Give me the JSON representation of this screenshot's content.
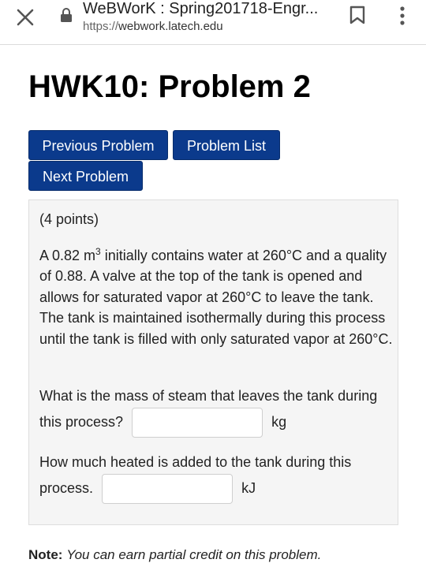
{
  "browser": {
    "tab_title": "WeBWorK : Spring201718-Engr...",
    "url_prefix": "https://",
    "url_host": "webwork.latech.edu"
  },
  "page": {
    "title": "HWK10: Problem 2"
  },
  "nav": {
    "previous_label": "Previous Problem",
    "list_label": "Problem List",
    "next_label": "Next Problem"
  },
  "problem": {
    "points": "(4 points)",
    "text_a": "A 0.82 m",
    "text_sup": "3",
    "text_b": " initially contains water at 260°C and a quality of 0.88. A valve at the top of the tank is opened and allows for saturated vapor at 260°C to leave the tank. The tank is maintained isothermally during this process until the tank is filled with only saturated vapor at 260°C.",
    "q1": {
      "text": "What is the mass of steam that leaves the tank during this process?",
      "value": "",
      "unit": "kg"
    },
    "q2": {
      "text": "How much heated is added to the tank during this process.",
      "value": "",
      "unit": "kJ"
    }
  },
  "note": {
    "label": "Note:",
    "text": "You can earn partial credit on this problem."
  },
  "colors": {
    "button": "#0b3a8c",
    "panel": "#f5f5f5"
  }
}
